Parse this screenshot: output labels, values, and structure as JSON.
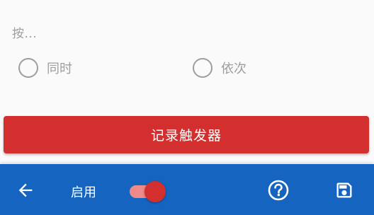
{
  "trigger": {
    "hint": "按...",
    "modes": [
      {
        "label": "同时",
        "selected": false
      },
      {
        "label": "依次",
        "selected": false
      }
    ],
    "record_button_label": "记录触发器"
  },
  "bottom_bar": {
    "back_icon": "arrow-left-icon",
    "enable_label": "启用",
    "enable_toggle_on": true,
    "help_icon": "help-circle-icon",
    "save_icon": "floppy-save-icon"
  },
  "colors": {
    "accent_red": "#d32f2f",
    "toggle_track": "#ef8a8a",
    "bottom_bar_blue": "#1565c0",
    "muted_gray": "#9e9e9e"
  }
}
